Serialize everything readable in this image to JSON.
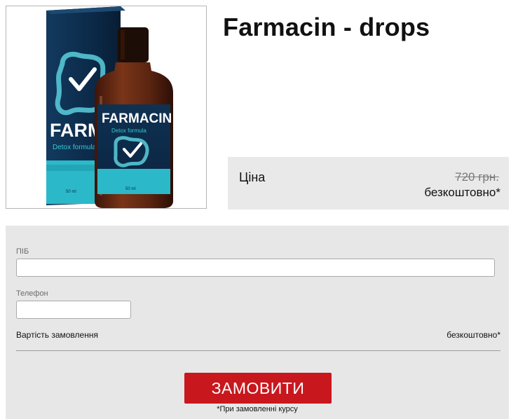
{
  "product": {
    "title": "Farmacin - drops",
    "box_brand": "FARMACIN",
    "box_subtitle": "Detox formula",
    "bottle_brand": "FARMACIN",
    "bottle_subtitle": "Detox formula",
    "box_volume": "50 ml",
    "bottle_volume": "50 ml",
    "colors": {
      "teal": "#35c9d6",
      "navy": "#0c2a49",
      "bottle": "#6a2d16"
    }
  },
  "price": {
    "label": "Ціна",
    "old_price": "720 грн.",
    "new_price": "безкоштовно*"
  },
  "form": {
    "name_label": "ПІБ",
    "name_value": "",
    "phone_label": "Телефон",
    "phone_value": "",
    "summary_label": "Вартість замовлення",
    "summary_value": "безкоштовно*",
    "submit_label": "ЗАМОВИТИ",
    "footnote": "*При замовленні курсу"
  },
  "colors": {
    "button": "#c9171e",
    "panel": "#e7e7e7",
    "price_panel": "#e9e9e9"
  }
}
